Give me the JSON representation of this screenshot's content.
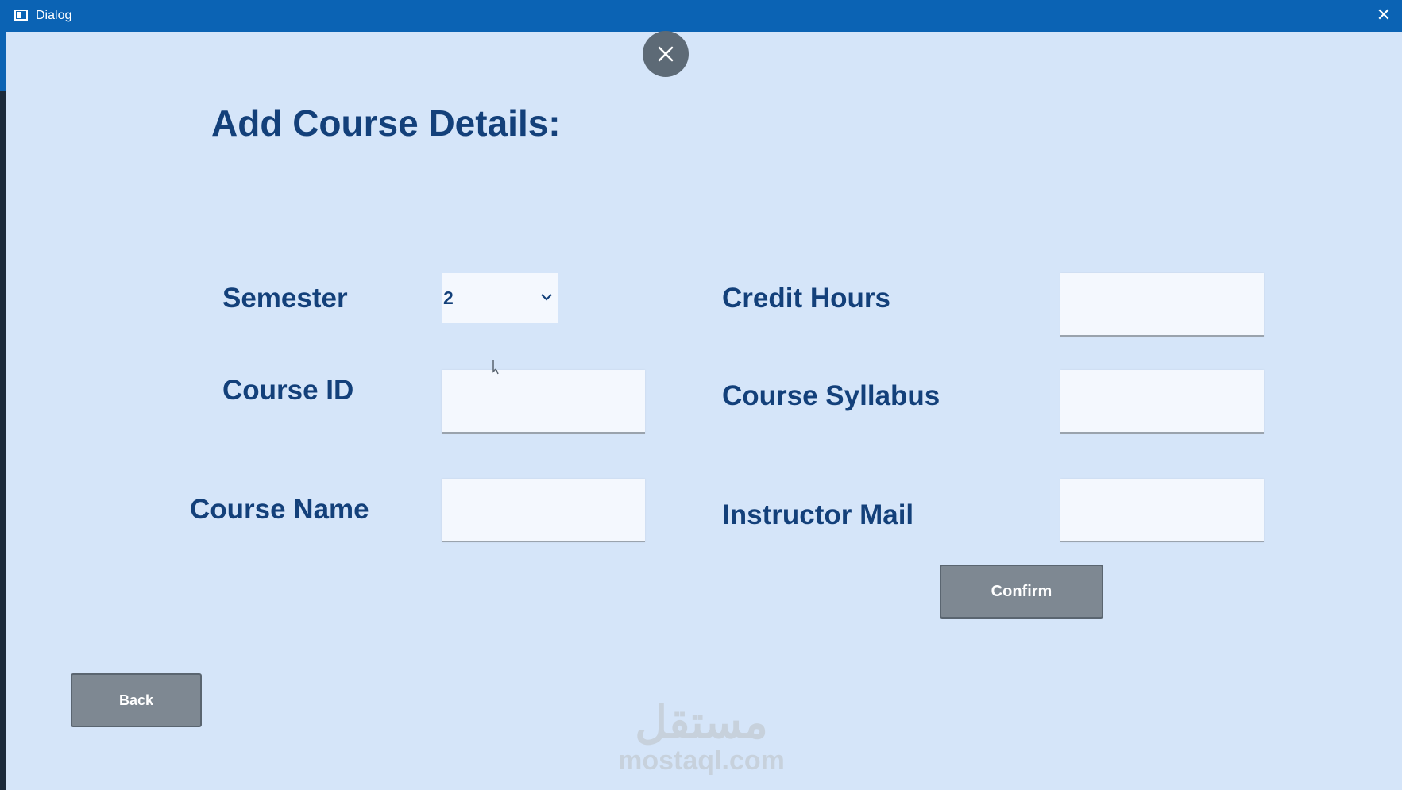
{
  "window": {
    "title": "Dialog",
    "close_glyph": "✕"
  },
  "dialog": {
    "heading": "Add Course Details:",
    "fields": {
      "semester": {
        "label": "Semester",
        "value": "2"
      },
      "course_id": {
        "label": "Course ID",
        "value": ""
      },
      "course_name": {
        "label": "Course Name",
        "value": ""
      },
      "credit_hours": {
        "label": "Credit Hours",
        "value": ""
      },
      "course_syllabus": {
        "label": "Course Syllabus",
        "value": ""
      },
      "instructor_mail": {
        "label": "Instructor Mail",
        "value": ""
      }
    },
    "buttons": {
      "confirm": "Confirm",
      "back": "Back"
    }
  },
  "watermark": {
    "arabic": "مستقل",
    "latin": "mostaql.com"
  },
  "icons": {
    "window_close": "close-icon",
    "dialog_close": "close-circle-icon",
    "select_arrow": "chevron-down-icon",
    "app": "app-window-icon"
  },
  "colors": {
    "titlebar": "#0b63b4",
    "background": "#d5e5f9",
    "text": "#13407a",
    "button": "#7e8892"
  }
}
